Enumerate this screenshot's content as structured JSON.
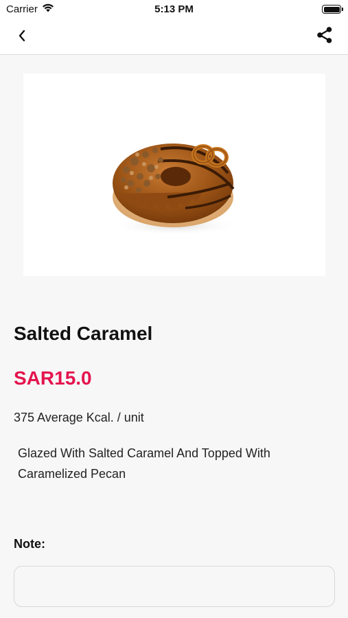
{
  "status_bar": {
    "carrier": "Carrier",
    "time": "5:13 PM",
    "wifi_icon": "wifi-icon",
    "battery_icon": "battery-full-icon"
  },
  "nav": {
    "back_icon": "chevron-left-icon",
    "share_icon": "share-icon"
  },
  "product": {
    "image_desc": "caramel-donut-image",
    "name": "Salted Caramel",
    "price": "SAR15.0",
    "kcal": "375 Average Kcal. / unit",
    "description": "Glazed With Salted Caramel And Topped With Caramelized Pecan"
  },
  "note": {
    "label": "Note:",
    "value": "",
    "placeholder": ""
  },
  "colors": {
    "price": "#e4144e",
    "background": "#f7f7f7"
  }
}
